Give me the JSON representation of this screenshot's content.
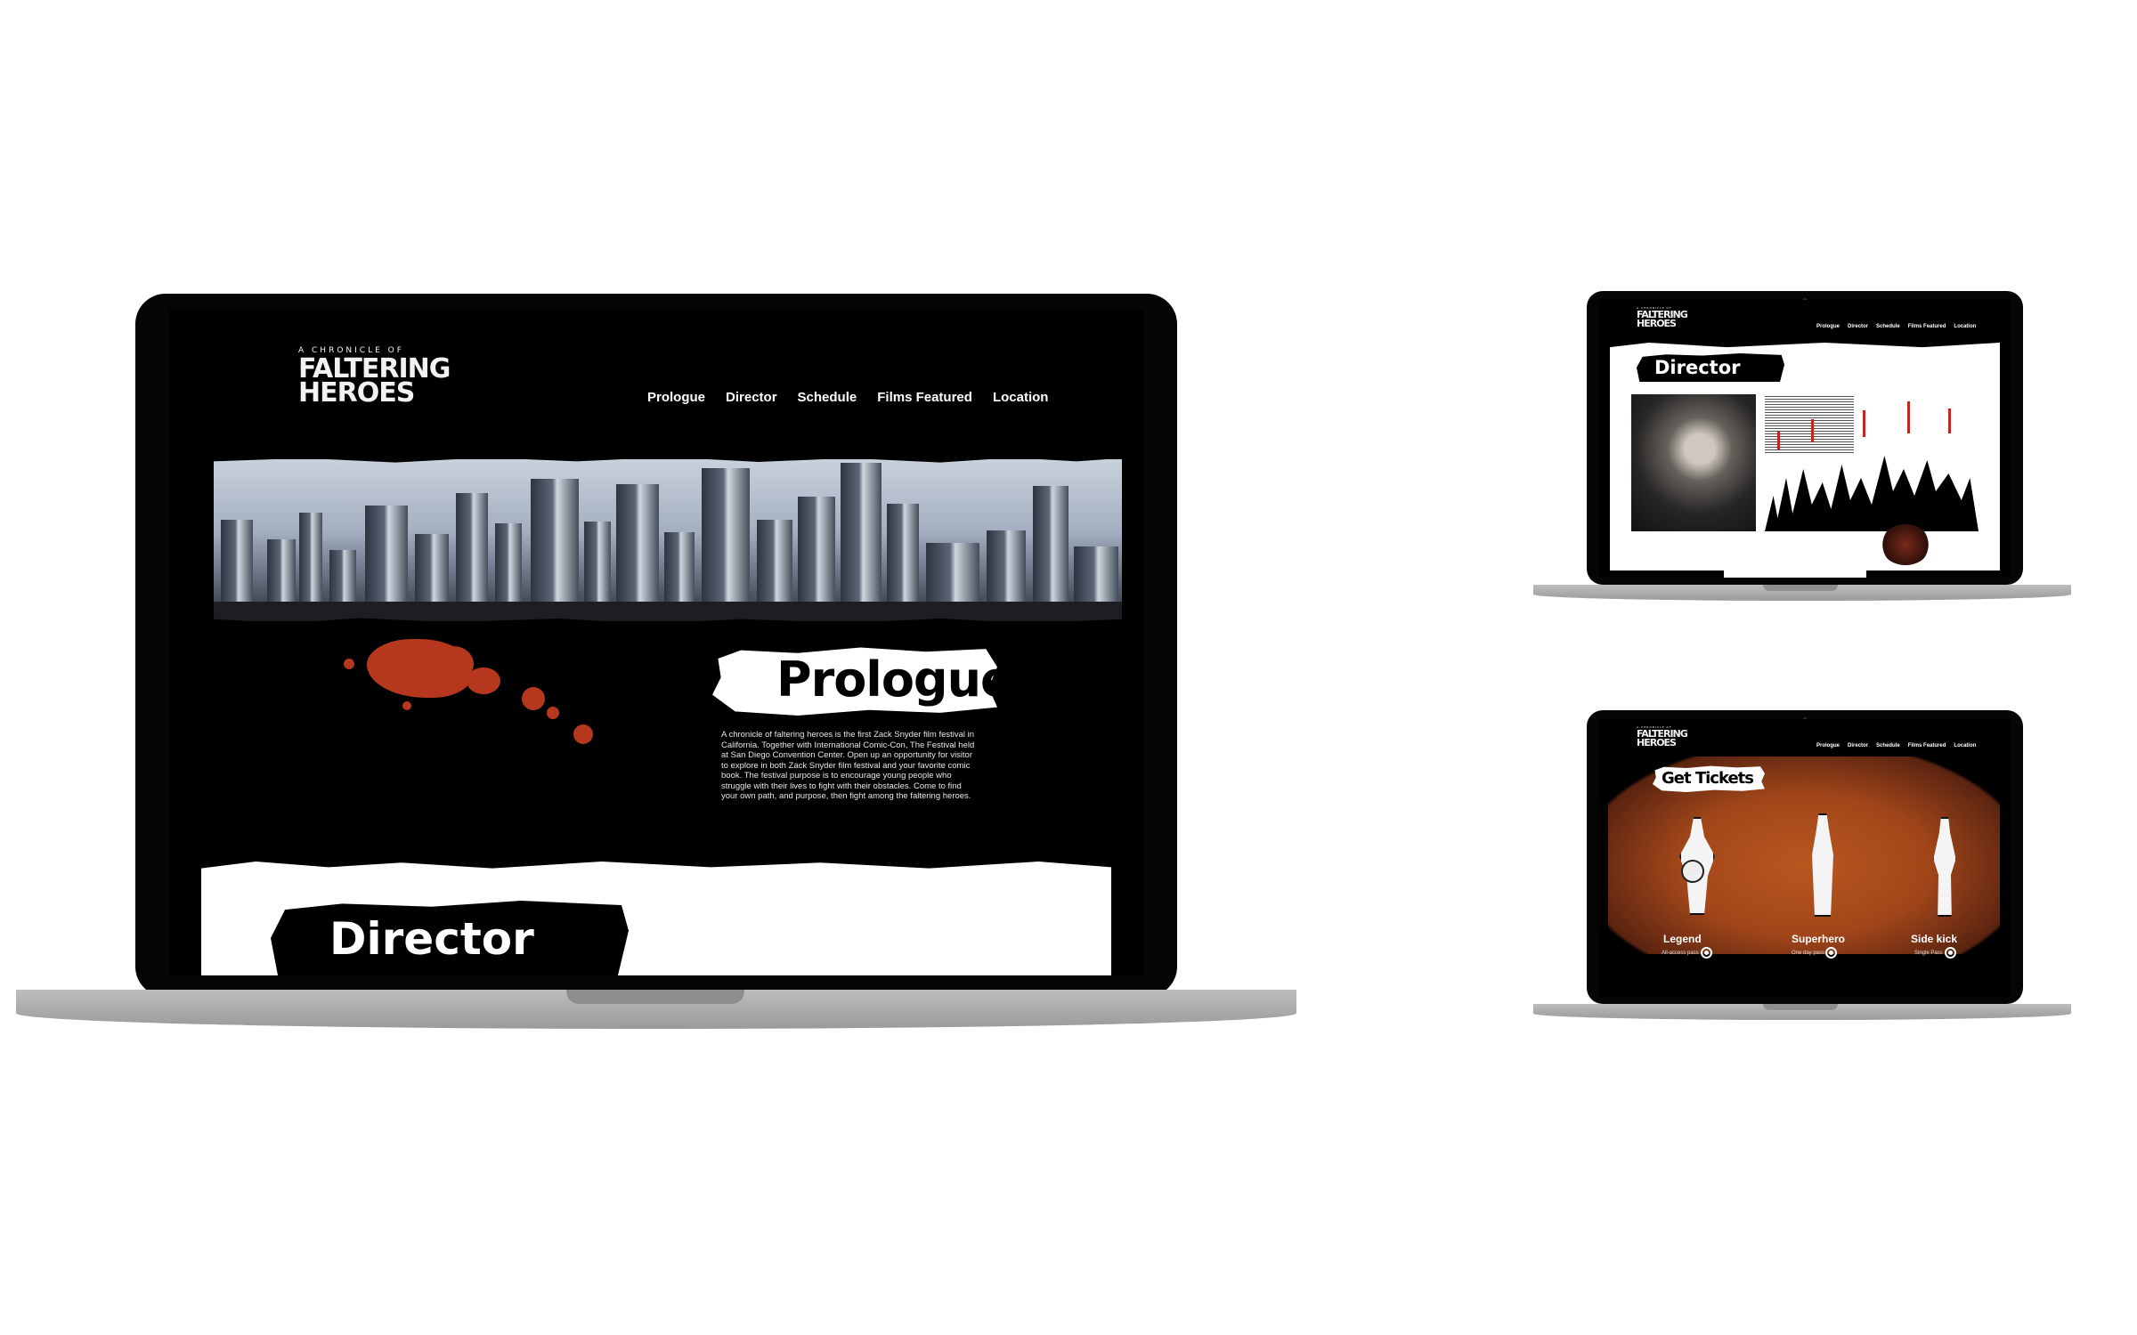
{
  "site": {
    "logo_small": "A CHRONICLE OF",
    "logo_line1": "FALTERING",
    "logo_line2": "HEROES",
    "nav": [
      "Prologue",
      "Director",
      "Schedule",
      "Films Featured",
      "Location"
    ]
  },
  "big_screen": {
    "section_title": "Prologue",
    "body": "A chronicle of faltering heroes is the first Zack Snyder film festival in California. Together with International Comic-Con, The Festival held at San Diego Convention Center. Open up an opportunity for visitor to explore in both Zack Snyder film festival and your favorite comic book. The festival purpose is to encourage young people who struggle with their lives to fight with their obstacles. Come to find your own path, and purpose, then fight among the faltering heroes.",
    "next_section_title": "Director"
  },
  "director_screen": {
    "section_title": "Director"
  },
  "tickets_screen": {
    "section_title": "Get Tickets",
    "tickets": [
      {
        "name": "Legend",
        "pass": "All-access pass"
      },
      {
        "name": "Superhero",
        "pass": "One day pass"
      },
      {
        "name": "Side kick",
        "pass": "Single Pass"
      }
    ]
  },
  "colors": {
    "accent_red": "#b5371e",
    "rust_orange": "#b8561e",
    "laptop_body": "#050505",
    "laptop_base": "#a8a8a8"
  },
  "icons": {
    "ticket_select": "radio-circle-icon",
    "webcam": "camera-dot-icon"
  }
}
